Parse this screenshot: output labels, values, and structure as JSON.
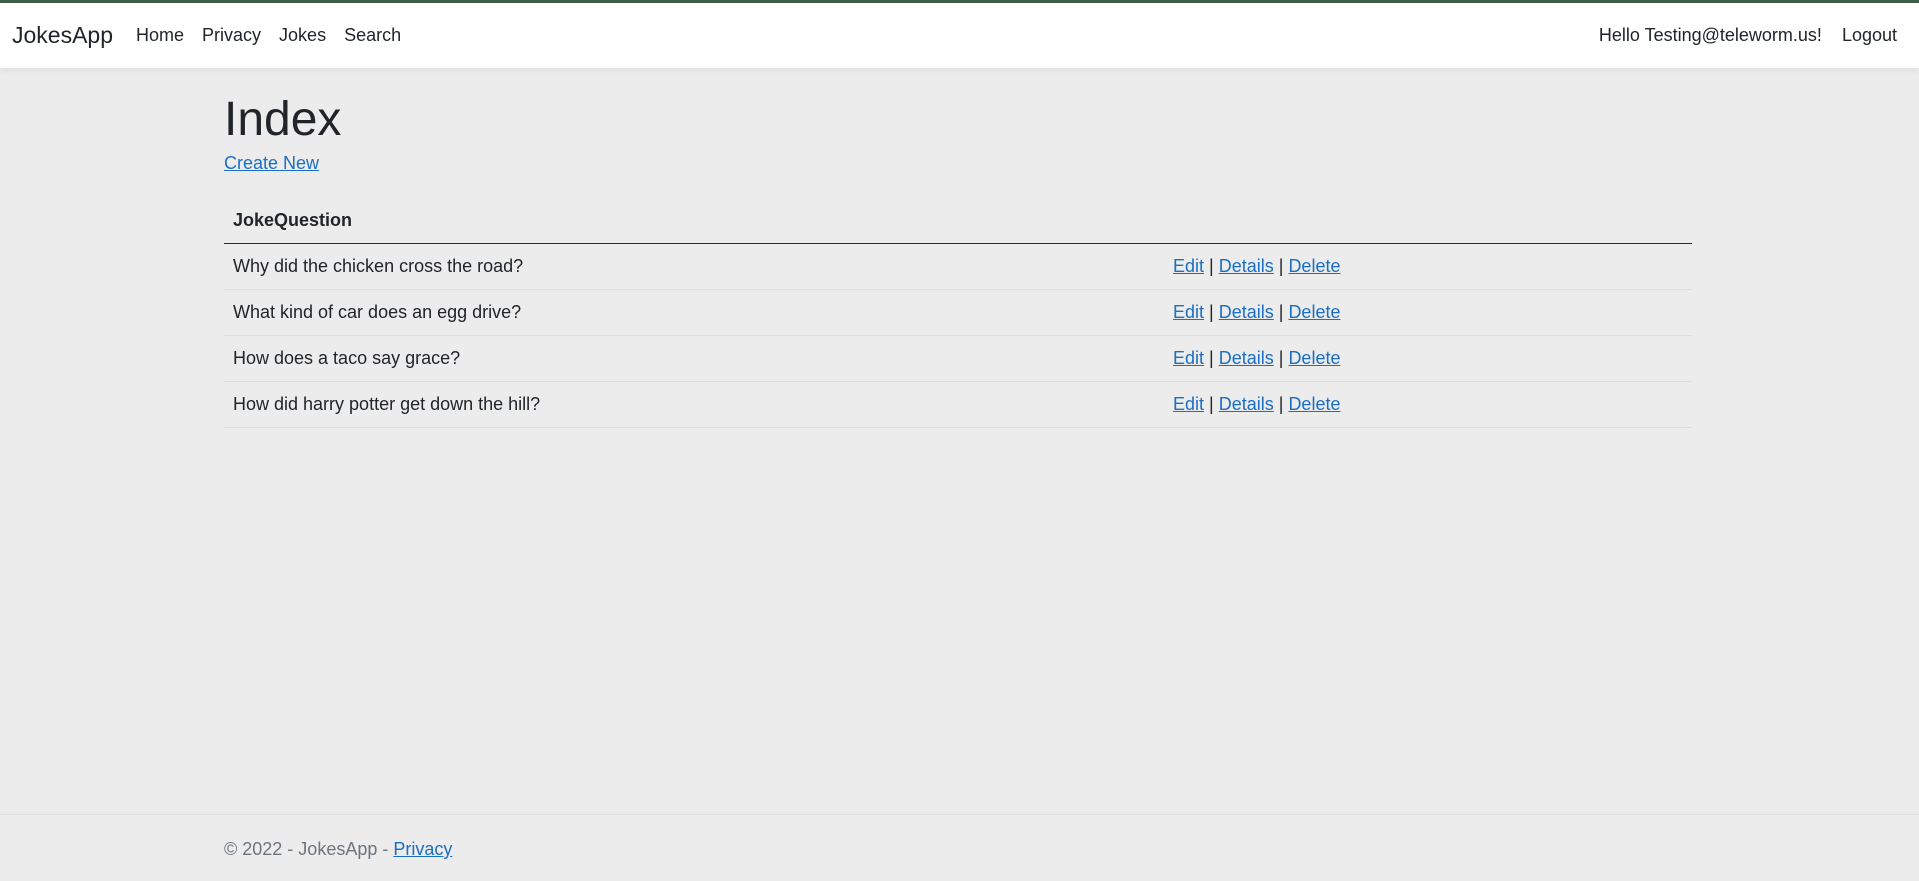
{
  "navbar": {
    "brand": "JokesApp",
    "links": [
      {
        "label": "Home"
      },
      {
        "label": "Privacy"
      },
      {
        "label": "Jokes"
      },
      {
        "label": "Search"
      }
    ],
    "greeting": "Hello Testing@teleworm.us!",
    "logout": "Logout"
  },
  "main": {
    "title": "Index",
    "create_new": "Create New",
    "table": {
      "column_header": "JokeQuestion",
      "rows": [
        {
          "question": "Why did the chicken cross the road?"
        },
        {
          "question": "What kind of car does an egg drive?"
        },
        {
          "question": "How does a taco say grace?"
        },
        {
          "question": "How did harry potter get down the hill?"
        }
      ],
      "actions": {
        "edit": "Edit",
        "details": "Details",
        "delete": "Delete",
        "separator": "|"
      }
    }
  },
  "footer": {
    "text": "© 2022 - JokesApp - ",
    "privacy_link": "Privacy"
  },
  "colors": {
    "link": "#1b6ec2",
    "background": "#ececec",
    "navbar_bg": "#ffffff",
    "top_accent": "#3f5f46"
  }
}
